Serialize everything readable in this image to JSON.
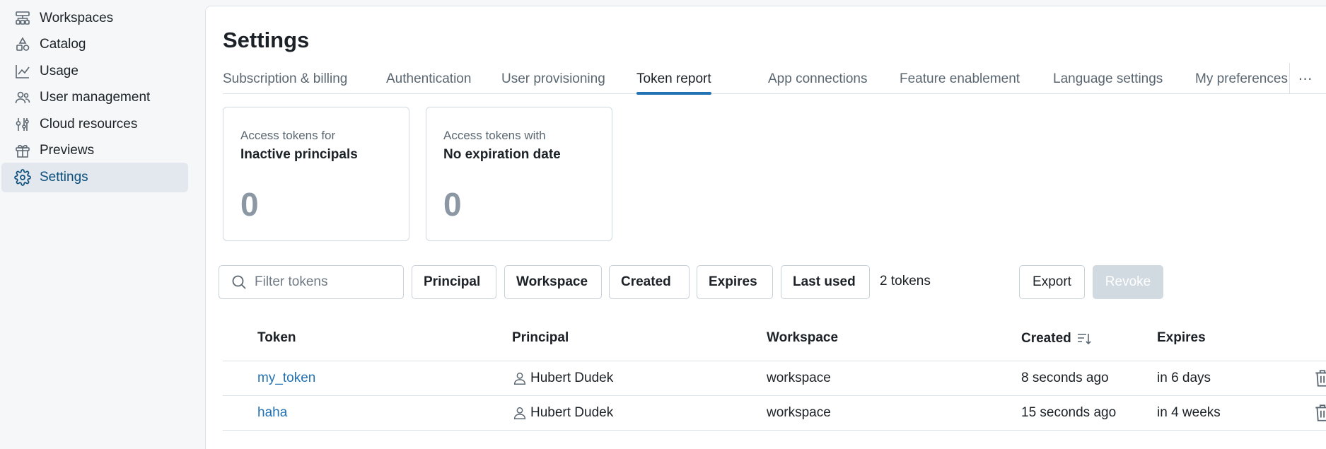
{
  "sidebar": {
    "items": [
      {
        "label": "Workspaces",
        "icon": "workspaces-icon"
      },
      {
        "label": "Catalog",
        "icon": "catalog-icon"
      },
      {
        "label": "Usage",
        "icon": "usage-chart-icon"
      },
      {
        "label": "User management",
        "icon": "users-icon"
      },
      {
        "label": "Cloud resources",
        "icon": "cloud-resources-icon"
      },
      {
        "label": "Previews",
        "icon": "gift-icon"
      },
      {
        "label": "Settings",
        "icon": "gear-icon",
        "active": true
      }
    ]
  },
  "page": {
    "title": "Settings"
  },
  "tabs": [
    {
      "label": "Subscription & billing"
    },
    {
      "label": "Authentication"
    },
    {
      "label": "User provisioning"
    },
    {
      "label": "Token report",
      "active": true
    },
    {
      "label": "App connections"
    },
    {
      "label": "Feature enablement"
    },
    {
      "label": "Language settings"
    },
    {
      "label": "My preferences"
    }
  ],
  "tabs_more": "⋯",
  "cards": [
    {
      "subtitle": "Access tokens for",
      "title": "Inactive principals",
      "value": "0"
    },
    {
      "subtitle": "Access tokens with",
      "title": "No expiration date",
      "value": "0"
    }
  ],
  "filters": {
    "search_placeholder": "Filter tokens",
    "dropdowns": [
      {
        "label": "Principal"
      },
      {
        "label": "Workspace"
      },
      {
        "label": "Created"
      },
      {
        "label": "Expires"
      },
      {
        "label": "Last used"
      }
    ],
    "count": "2 tokens",
    "export_label": "Export",
    "revoke_label": "Revoke"
  },
  "table": {
    "columns": {
      "token": "Token",
      "principal": "Principal",
      "workspace": "Workspace",
      "created": "Created",
      "expires": "Expires"
    },
    "rows": [
      {
        "token": "my_token",
        "principal": "Hubert Dudek",
        "workspace": "workspace",
        "created": "8 seconds ago",
        "expires": "in 6 days"
      },
      {
        "token": "haha",
        "principal": "Hubert Dudek",
        "workspace": "workspace",
        "created": "15 seconds ago",
        "expires": "in 4 weeks"
      }
    ]
  },
  "colors": {
    "accent": "#2272b4",
    "active_nav_bg": "#e3e8ee",
    "active_nav_text": "#0b4f7c",
    "disabled_button": "#d1d9e1"
  }
}
